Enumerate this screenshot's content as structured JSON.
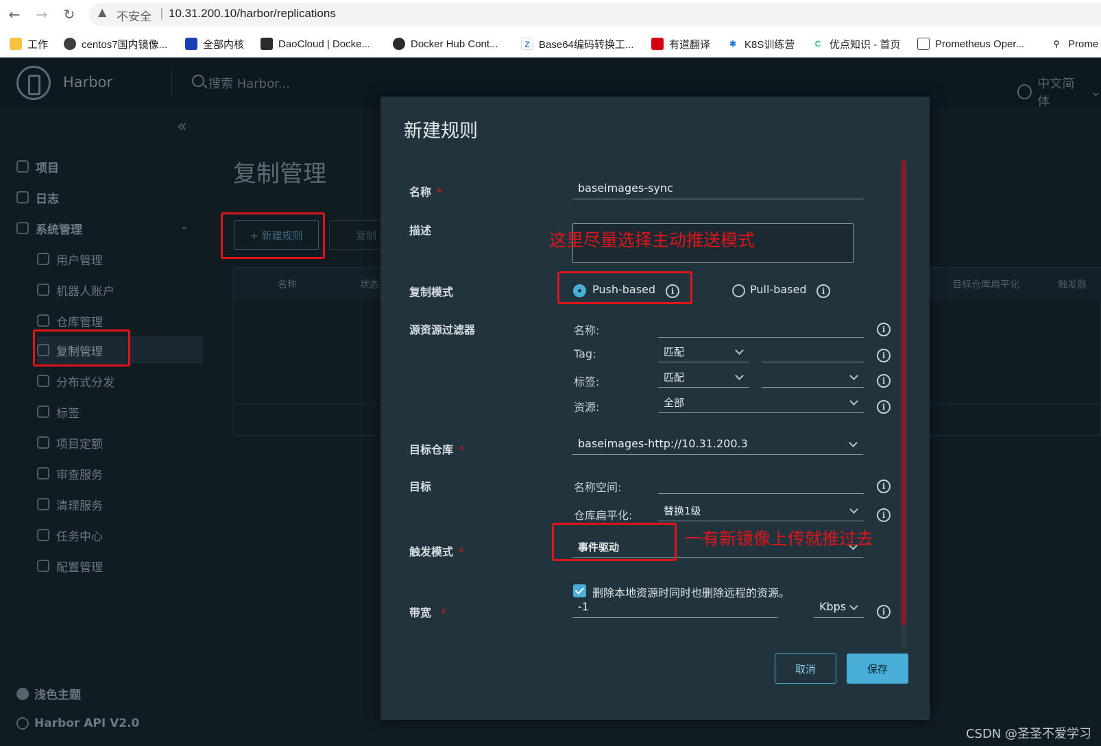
{
  "browser": {
    "insecure_label": "不安全",
    "url": "10.31.200.10/harbor/replications",
    "bookmarks": [
      "工作",
      "centos7国内镜像...",
      "全部内核",
      "DaoCloud | Docke...",
      "Docker Hub Cont...",
      "Base64编码转换工...",
      "有道翻译",
      "K8S训练营",
      "优点知识 - 首页",
      "Prometheus Oper...",
      "Prome"
    ]
  },
  "header": {
    "brand": "Harbor",
    "search_placeholder": "搜索 Harbor...",
    "language": "中文简体"
  },
  "sidebar": {
    "items": [
      {
        "label": "项目"
      },
      {
        "label": "日志"
      },
      {
        "label": "系统管理"
      }
    ],
    "sub_items": [
      {
        "label": "用户管理"
      },
      {
        "label": "机器人账户"
      },
      {
        "label": "仓库管理"
      },
      {
        "label": "复制管理"
      },
      {
        "label": "分布式分发"
      },
      {
        "label": "标签"
      },
      {
        "label": "项目定额"
      },
      {
        "label": "审查服务"
      },
      {
        "label": "清理服务"
      },
      {
        "label": "任务中心"
      },
      {
        "label": "配置管理"
      }
    ],
    "theme_toggle": "浅色主题",
    "api_link": "Harbor API V2.0"
  },
  "page": {
    "title": "复制管理",
    "new_rule_button": "+ 新建规则",
    "copy_button": "复制",
    "columns": [
      "名称",
      "状态",
      "目标仓库扁平化",
      "触发器"
    ]
  },
  "modal": {
    "title": "新建规则",
    "name_label": "名称",
    "name_value": "baseimages-sync",
    "desc_label": "描述",
    "mode_label": "复制模式",
    "push_based": "Push-based",
    "pull_based": "Pull-based",
    "filter_label": "源资源过滤器",
    "filter_name": "名称:",
    "filter_tag": "Tag:",
    "filter_tag_value": "匹配",
    "filter_labels": "标签:",
    "filter_labels_value": "匹配",
    "filter_resource": "资源:",
    "filter_resource_value": "全部",
    "dest_registry_label": "目标仓库",
    "dest_registry_value": "baseimages-http://10.31.200.3",
    "dest_label": "目标",
    "namespace_label": "名称空间:",
    "flatten_label": "仓库扁平化:",
    "flatten_value": "替换1级",
    "trigger_label": "触发模式",
    "trigger_value": "事件驱动",
    "delete_remote_text": "删除本地资源时同时也删除远程的资源。",
    "bandwidth_label": "带宽",
    "bandwidth_value": "-1",
    "bandwidth_unit": "Kbps",
    "cancel_button": "取消",
    "save_button": "保存",
    "required_mark": "*"
  },
  "annotations": {
    "push_note": "这里尽量选择主动推送模式",
    "trigger_note": "一有新镜像上传就推过去"
  },
  "watermark": "CSDN @圣圣不爱学习",
  "colors": {
    "accent": "#49afd9",
    "annotation_red": "#e0141b",
    "modal_bg": "#21333d"
  }
}
